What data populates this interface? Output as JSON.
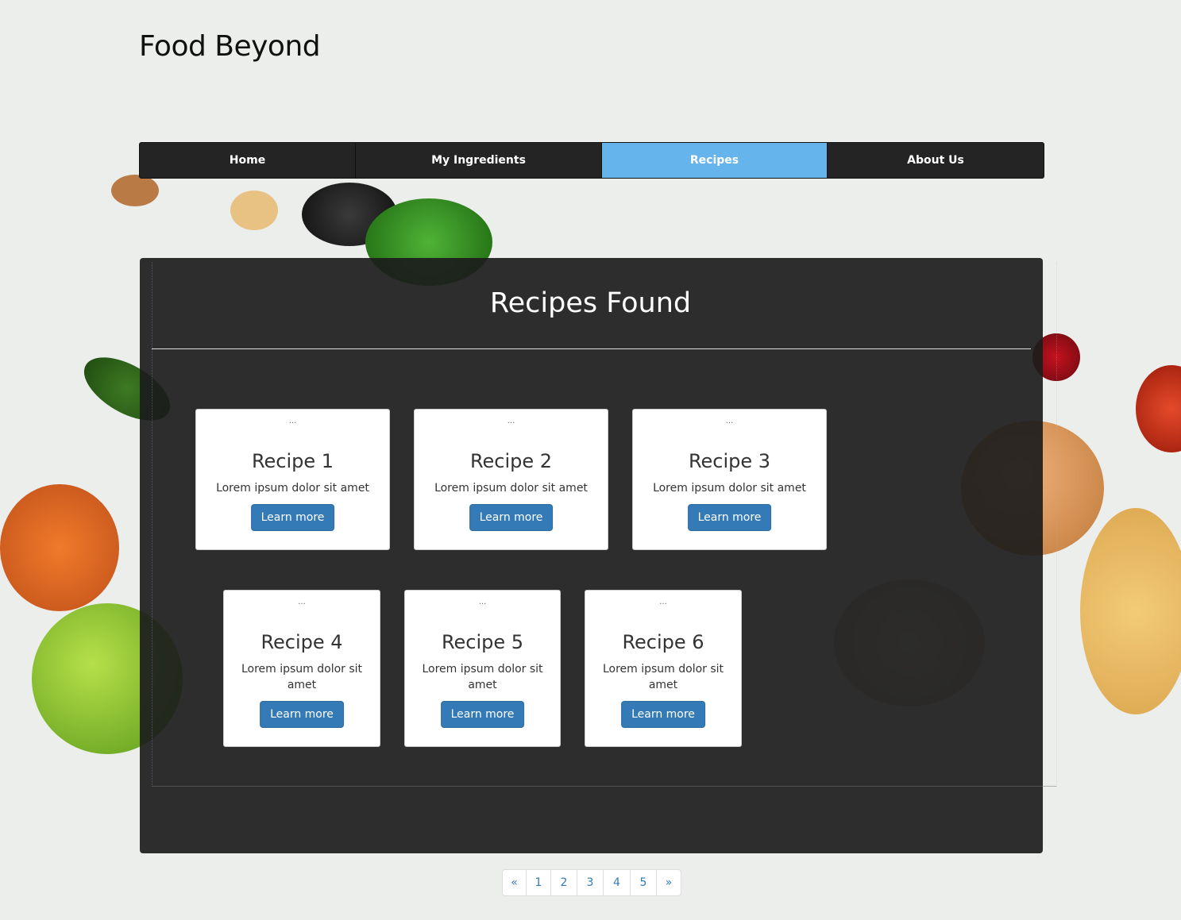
{
  "site": {
    "title": "Food Beyond"
  },
  "nav": {
    "items": [
      {
        "label": "Home",
        "active": false
      },
      {
        "label": "My Ingredients",
        "active": false
      },
      {
        "label": "Recipes",
        "active": true
      },
      {
        "label": "About Us",
        "active": false
      }
    ]
  },
  "panel": {
    "title": "Recipes Found"
  },
  "cards": [
    {
      "dots": "...",
      "title": "Recipe 1",
      "description": "Lorem ipsum dolor sit amet",
      "button": "Learn more"
    },
    {
      "dots": "...",
      "title": "Recipe 2",
      "description": "Lorem ipsum dolor sit amet",
      "button": "Learn more"
    },
    {
      "dots": "...",
      "title": "Recipe 3",
      "description": "Lorem ipsum dolor sit amet",
      "button": "Learn more"
    },
    {
      "dots": "...",
      "title": "Recipe 4",
      "description": "Lorem ipsum dolor sit amet",
      "button": "Learn more"
    },
    {
      "dots": "...",
      "title": "Recipe 5",
      "description": "Lorem ipsum dolor sit amet",
      "button": "Learn more"
    },
    {
      "dots": "...",
      "title": "Recipe 6",
      "description": "Lorem ipsum dolor sit amet",
      "button": "Learn more"
    }
  ],
  "pagination": {
    "prev": "«",
    "pages": [
      "1",
      "2",
      "3",
      "4",
      "5"
    ],
    "next": "»"
  },
  "colors": {
    "nav_active": "#66b4ec",
    "button": "#337ab7",
    "panel": "#1c1c1c"
  }
}
